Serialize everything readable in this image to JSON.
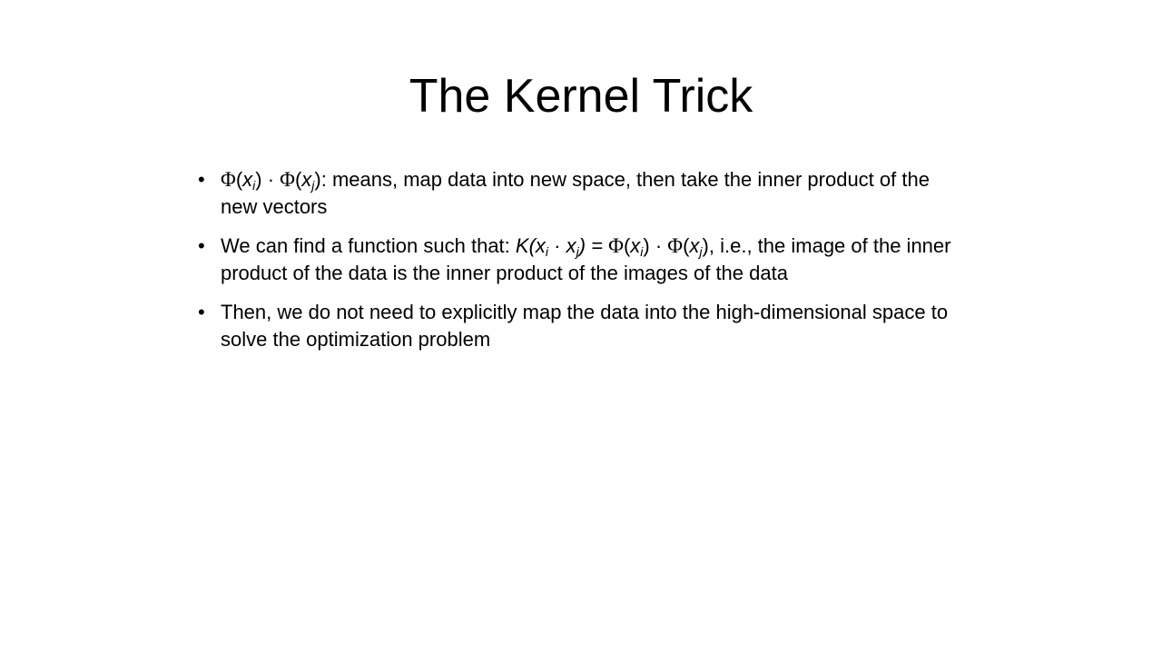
{
  "slide": {
    "title": "The Kernel Trick",
    "bullet_glyph": "•",
    "bullets": [
      {
        "phi_a": "Φ",
        "open_a": "(",
        "x_a": "x",
        "sub_a": "i",
        "close_a": ")",
        "dot_a": " · ",
        "phi_b": "Φ",
        "open_b": "(",
        "x_b": "x",
        "sub_b": "j",
        "rest": "): means, map data into new space, then take the inner product of the new vectors"
      },
      {
        "lead": "We can find a function such that: ",
        "k_open": "K(x",
        "k_sub_i": "i",
        "k_mid": " · x",
        "k_sub_j": "j",
        "k_close": ") = ",
        "phi_a": "Φ",
        "open_a": "(",
        "x_a": "x",
        "sub_a": "i",
        "close_a": ")",
        "dot": " · ",
        "phi_b": "Φ",
        "open_b": "(",
        "x_b": "x",
        "sub_b": "j",
        "rest": "), i.e., the image of the inner product of the data is the inner product of the images of the data"
      },
      {
        "text": "Then, we do not need to explicitly map the data into the high-dimensional space to solve the optimization problem"
      }
    ]
  }
}
